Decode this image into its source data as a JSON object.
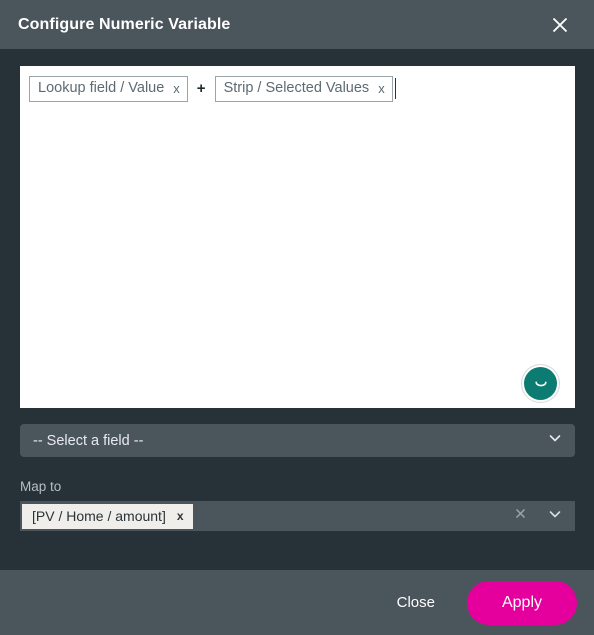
{
  "dialog": {
    "title": "Configure Numeric Variable",
    "close_icon": "close-icon"
  },
  "formula_editor": {
    "tokens": [
      {
        "label": "Lookup field / Value",
        "remove": "x"
      },
      {
        "label": "Strip / Selected Values",
        "remove": "x"
      }
    ],
    "operator": "+",
    "chat_launcher_icon": "chat-bubble-icon"
  },
  "field_select": {
    "value": "-- Select a field --",
    "chevron_icon": "chevron-down-icon"
  },
  "map_to": {
    "label": "Map to",
    "chip": {
      "label": "[PV / Home / amount]",
      "remove": "x"
    },
    "clear_icon": "close-icon",
    "chevron_icon": "chevron-down-icon"
  },
  "footer": {
    "close_label": "Close",
    "apply_label": "Apply"
  },
  "colors": {
    "accent": "#E5009E",
    "header_bg": "#4B555C",
    "body_bg": "#263238",
    "chat_teal": "#0C7C72"
  }
}
